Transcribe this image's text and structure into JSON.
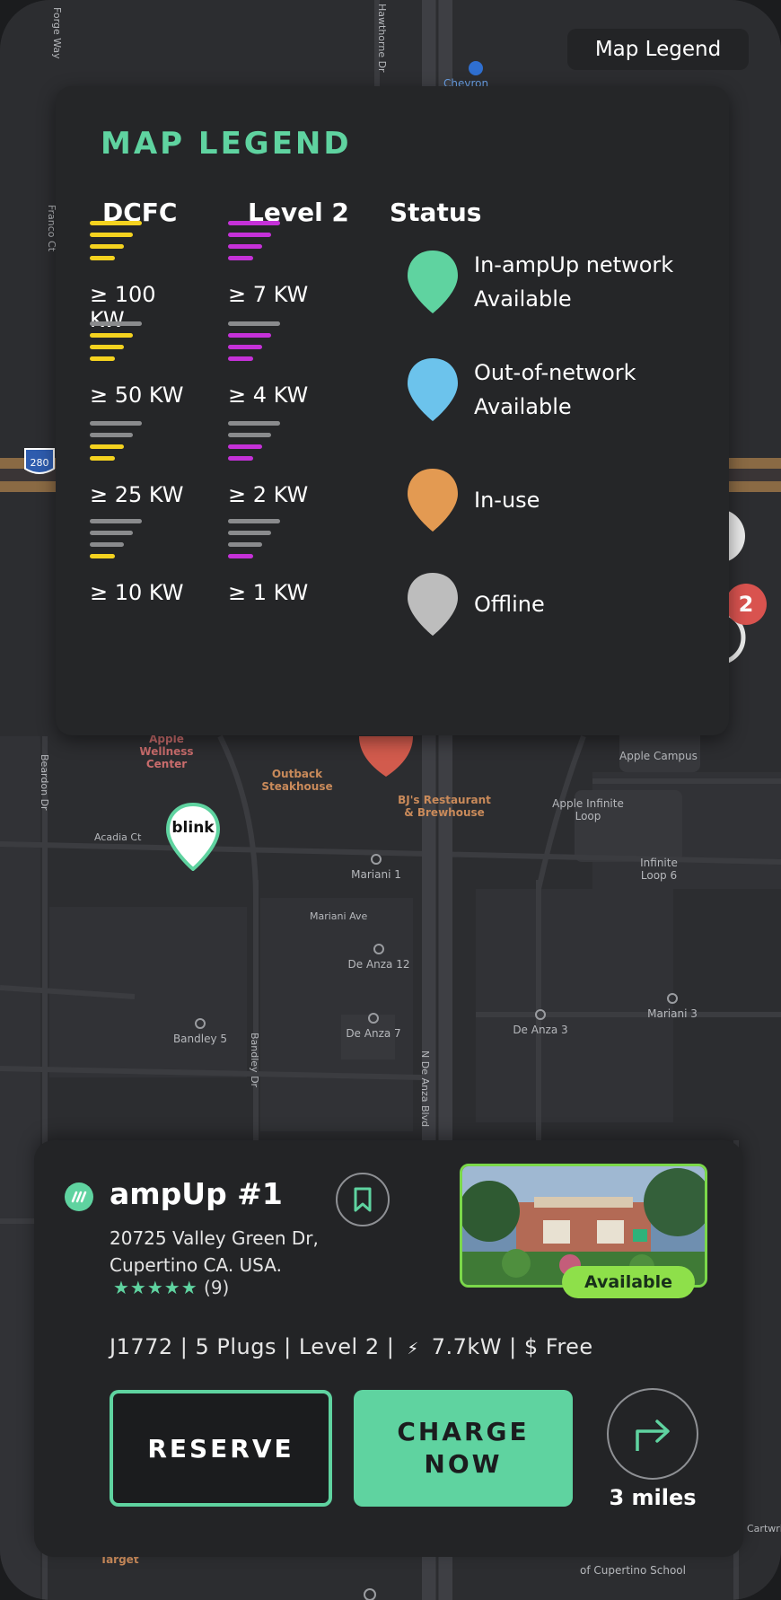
{
  "map": {
    "street_labels": [
      "Forge Way",
      "Hawthorne Dr",
      "Franco Ct",
      "Beardon Dr",
      "Acadia Ct",
      "Mariani Ave",
      "Bandley Dr",
      "N De Anza Blvd",
      "Cartwright"
    ],
    "highway_shield": "280",
    "pois": [
      {
        "name": "Chevron"
      },
      {
        "name": "Apple Wellness Center"
      },
      {
        "name": "Outback Steakhouse"
      },
      {
        "name": "BJ's Restaurant & Brewhouse"
      },
      {
        "name": "Apple Campus"
      },
      {
        "name": "Apple Infinite Loop"
      },
      {
        "name": "Infinite Loop 6"
      },
      {
        "name": "Mariani 1"
      },
      {
        "name": "De Anza 12"
      },
      {
        "name": "Mariani 3"
      },
      {
        "name": "De Anza 3"
      },
      {
        "name": "De Anza 7"
      },
      {
        "name": "Bandley 5"
      },
      {
        "name": "Target"
      },
      {
        "name": "of Cupertino School"
      }
    ],
    "cluster_count": "2",
    "blink_marker_label": "blink"
  },
  "legend_toggle": {
    "label": "Map Legend"
  },
  "legend": {
    "title": "MAP LEGEND",
    "columns": {
      "dcfc": "DCFC",
      "level2": "Level 2",
      "status": "Status"
    },
    "dcfc_tiers": [
      {
        "label": "≥ 100 KW",
        "filled": 4
      },
      {
        "label": "≥ 50 KW",
        "filled": 3
      },
      {
        "label": "≥ 25 KW",
        "filled": 2
      },
      {
        "label": "≥ 10 KW",
        "filled": 1
      }
    ],
    "level2_tiers": [
      {
        "label": "≥ 7 KW",
        "filled": 4
      },
      {
        "label": "≥ 4 KW",
        "filled": 3
      },
      {
        "label": "≥ 2 KW",
        "filled": 2
      },
      {
        "label": "≥ 1 KW",
        "filled": 1
      }
    ],
    "statuses": [
      {
        "line1": "In-ampUp network",
        "line2": "Available",
        "color": "#5fd3a0"
      },
      {
        "line1": "Out-of-network",
        "line2": "Available",
        "color": "#6cc3ec"
      },
      {
        "line1": "In-use",
        "line2": "",
        "color": "#e39a52"
      },
      {
        "line1": "Offline",
        "line2": "",
        "color": "#bdbdbd"
      }
    ],
    "colors": {
      "dcfc": "#f4d21f",
      "level2": "#c531d8",
      "inactive_bar": "#8a8b8d"
    }
  },
  "station": {
    "name": "ampUp #1",
    "address_line1": "20725 Valley Green Dr,",
    "address_line2": "Cupertino CA.  USA.",
    "stars": "★★★★★",
    "review_count": "(9)",
    "status_badge": "Available",
    "specs_before": "J1772 | 5 Plugs | Level 2 |",
    "specs_after": "7.7kW | $ Free",
    "reserve_label": "RESERVE",
    "charge_label": "CHARGE\nNOW",
    "distance": "3 miles"
  },
  "colors": {
    "accent": "#5fd3a0",
    "available": "#8ee04a"
  }
}
